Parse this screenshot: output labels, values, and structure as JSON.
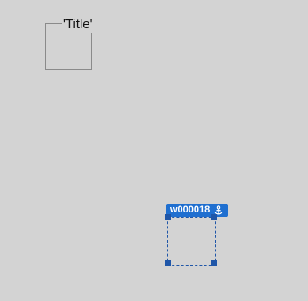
{
  "app": {
    "groupbox": {
      "title": "'Title'"
    },
    "selection": {
      "widget_id": "w000018",
      "tag_icon": "anchor-icon",
      "accent_color": "#1f6fd0",
      "outline_color": "#1f56a8"
    }
  }
}
